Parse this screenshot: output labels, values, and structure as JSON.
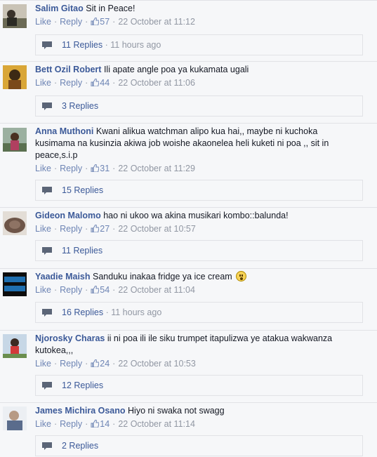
{
  "labels": {
    "like": "Like",
    "reply": "Reply",
    "dot": "·"
  },
  "colors": {
    "author": "#3b5998",
    "link": "#6d84b4",
    "meta": "#9197a3",
    "panel": "#f6f7f9"
  },
  "comments": [
    {
      "author": "Salim Gitao",
      "text": "Sit in Peace!",
      "likes": "57",
      "time": "22 October at 11:12",
      "replies": "11 Replies",
      "replies_time": "11 hours ago",
      "avatar": "avatar-photo"
    },
    {
      "author": "Bett Ozil Robert",
      "text": "Ili apate angle poa ya kukamata ugali",
      "likes": "44",
      "time": "22 October at 11:06",
      "replies": "3 Replies",
      "replies_time": "",
      "avatar": "avatar-photo"
    },
    {
      "author": "Anna Muthoni",
      "text": "Kwani alikua watchman alipo kua hai,, maybe ni kuchoka kusimama na kusinzia akiwa job woishe akaonelea heli kuketi ni poa ,, sit in peace,s.i.p",
      "likes": "31",
      "time": "22 October at 11:29",
      "replies": "15 Replies",
      "replies_time": "",
      "avatar": "avatar-photo"
    },
    {
      "author": "Gideon Malomo",
      "text": "hao ni ukoo wa akina musikari kombo::balunda!",
      "likes": "27",
      "time": "22 October at 10:57",
      "replies": "11 Replies",
      "replies_time": "",
      "avatar": "avatar-photo"
    },
    {
      "author": "Yaadie Maish",
      "text": "Sanduku inakaa fridge ya ice cream",
      "likes": "54",
      "time": "22 October at 11:04",
      "replies": "16 Replies",
      "replies_time": "11 hours ago",
      "avatar": "avatar-photo",
      "emoji": "surprised-emoji-icon"
    },
    {
      "author": "Njorosky Charas",
      "text": "ii ni poa ili ile siku trumpet itapulizwa ye atakua wakwanza kutokea,,,",
      "likes": "24",
      "time": "22 October at 10:53",
      "replies": "12 Replies",
      "replies_time": "",
      "avatar": "avatar-photo"
    },
    {
      "author": "James Michira Osano",
      "text": "Hiyo ni swaka not swagg",
      "likes": "14",
      "time": "22 October at 11:14",
      "replies": "2 Replies",
      "replies_time": "",
      "avatar": "avatar-photo"
    }
  ]
}
